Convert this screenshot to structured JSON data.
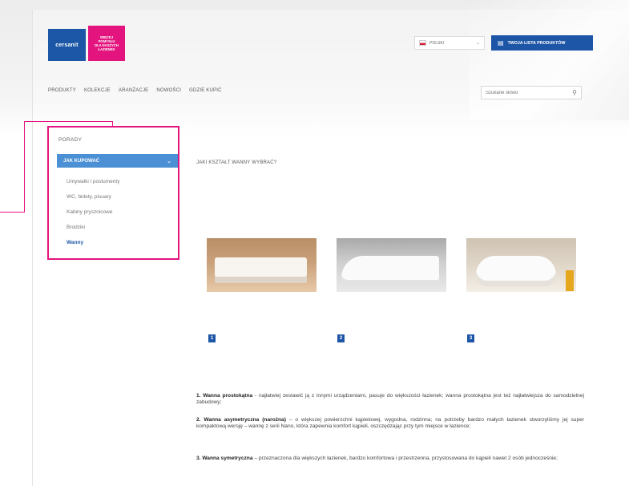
{
  "header": {
    "logo_blue_text": "cersanit",
    "logo_pink_lines": [
      "WIĘCEJ",
      "POMYSŁU",
      "DLA NASZYCH",
      "ŁAZIENEK"
    ],
    "language": "POLSKI",
    "list_button_label": "TWOJA LISTA PRODUKTÓW"
  },
  "nav": {
    "items": [
      "PRODUKTY",
      "KOLEKCJE",
      "ARANŻACJE",
      "NOWOŚCI",
      "GDZIE KUPIĆ"
    ]
  },
  "search": {
    "placeholder": "Szukane słowo"
  },
  "sidebar": {
    "title": "PORADY",
    "active_label": "JAK KUPOWAĆ",
    "items": [
      "Umywalki i postumenty",
      "WC, bidety, pisuary",
      "Kabiny prysznicowe",
      "Brodziki",
      "Wanny"
    ],
    "current_item": "Wanny"
  },
  "main": {
    "heading": "JAKI KSZTAŁT WANNY WYBRAĆ?",
    "numbers": [
      "1",
      "2",
      "3"
    ],
    "paragraphs": [
      {
        "bold": "1. Wanna prostokątna",
        "text": " - najłatwiej zestawić ją z innymi urządzeniami, pasuje do większości łazienek; wanna prostokątna jest też najłatwiejsza do samodzielnej zabudowy;"
      },
      {
        "bold": "2. Wanna asymetryczna (narożna)",
        "text": " – o większej powierzchni kąpielowej, wygodna, rodzinna; na potrzeby bardzo małych łazienek stworzyliśmy jej super kompaktową wersję – wannę z serii Nano, która zapewnia komfort kąpieli, oszczędzając przy tym miejsce w łazience;"
      },
      {
        "bold": "3. Wanna symetryczna",
        "text": " – przeznaczona dla większych łazienek, bardzo komfortowa i przestrzenna, przystosowana do kąpieli nawet 2 osób jednocześnie;"
      }
    ]
  },
  "colors": {
    "brand_blue": "#1e56a7",
    "accent_pink": "#e4147f",
    "active_blue": "#4b8fd4"
  }
}
